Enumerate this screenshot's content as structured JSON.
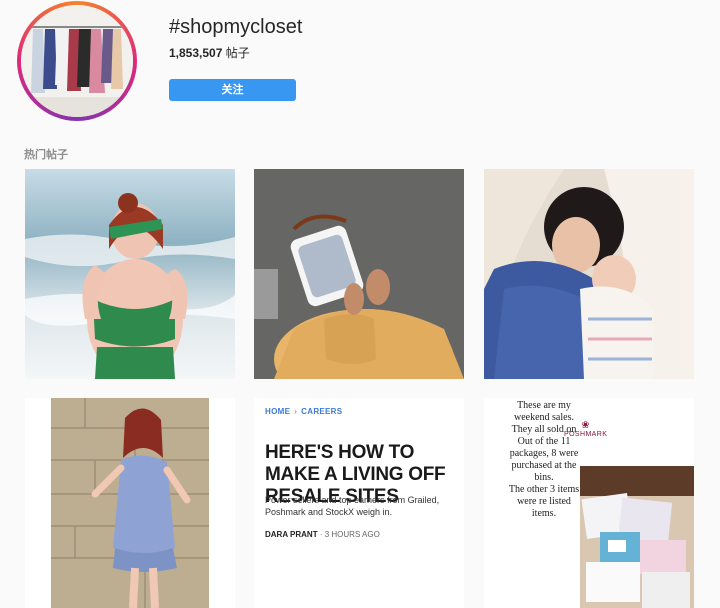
{
  "header": {
    "hashtag": "#shopmycloset",
    "post_count": "1,853,507",
    "post_count_suffix": "帖子",
    "follow_label": "关注",
    "avatar_icon": "closet-rack-photo"
  },
  "section": {
    "title": "热门帖子"
  },
  "posts": [
    {
      "description": "beach-swimsuit-photo"
    },
    {
      "description": "handbag-shoes-photo"
    },
    {
      "description": "mother-newborn-photo"
    },
    {
      "description": "blue-dress-stone-wall-photo"
    },
    {
      "breadcrumb_home": "HOME",
      "breadcrumb_sep": "›",
      "breadcrumb_section": "CAREERS",
      "headline": "HERE'S HOW TO MAKE A LIVING OFF RESALE SITES",
      "summary": "Power sellers and top earners from Grailed, Poshmark and StockX weigh in.",
      "author": "DARA PRANT",
      "time": "· 3 HOURS AGO"
    },
    {
      "note": "These are my weekend sales. They all sold on Out of the 11 packages, 8 were purchased at the bins. The other 3 items were re listed items.",
      "note_lines": [
        "These are my",
        "weekend sales.",
        "They all sold on",
        "Out of the 11",
        "packages, 8 were",
        "purchased at the",
        "bins.",
        "The other 3 items",
        "were re listed",
        "items."
      ],
      "logo_text": "POSHMARK"
    }
  ],
  "colors": {
    "follow_button": "#3897f0",
    "link": "#3c7ad6",
    "background": "#fafafa"
  }
}
